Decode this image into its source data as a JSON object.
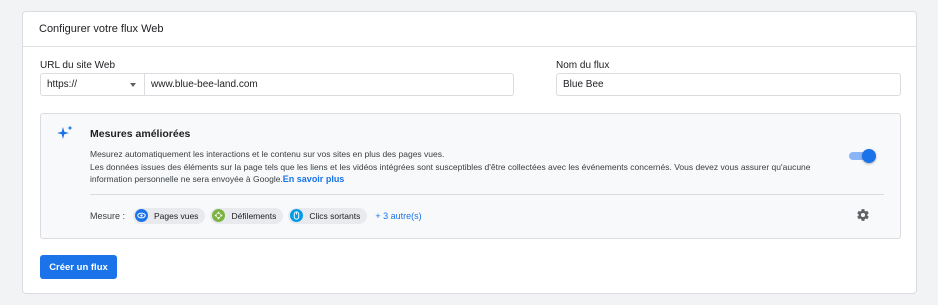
{
  "header": {
    "title": "Configurer votre flux Web"
  },
  "url_field": {
    "label": "URL du site Web",
    "protocol": "https://",
    "value": "www.blue-bee-land.com"
  },
  "name_field": {
    "label": "Nom du flux",
    "value": "Blue Bee"
  },
  "enhanced": {
    "title": "Mesures améliorées",
    "desc_line1": "Mesurez automatiquement les interactions et le contenu sur vos sites en plus des pages vues.",
    "desc_line2": "Les données issues des éléments sur la page tels que les liens et les vidéos intégrées sont susceptibles d'être collectées avec les événements concernés. Vous devez vous assurer qu'aucune information personnelle ne sera envoyée à Google.",
    "learn_more": "En savoir plus",
    "toggle_on": true,
    "measure_label": "Mesure :",
    "chips": [
      {
        "label": "Pages vues",
        "icon": "eye-icon",
        "color": "#1a73e8"
      },
      {
        "label": "Défilements",
        "icon": "scroll-arrows-icon",
        "color": "#7cb342"
      },
      {
        "label": "Clics sortants",
        "icon": "mouse-icon",
        "color": "#039be5"
      }
    ],
    "more": "+ 3 autre(s)"
  },
  "create_button": {
    "label": "Créer un flux"
  },
  "colors": {
    "accent": "#1a73e8",
    "border": "#dadce0",
    "panel": "#f8f9fa"
  }
}
